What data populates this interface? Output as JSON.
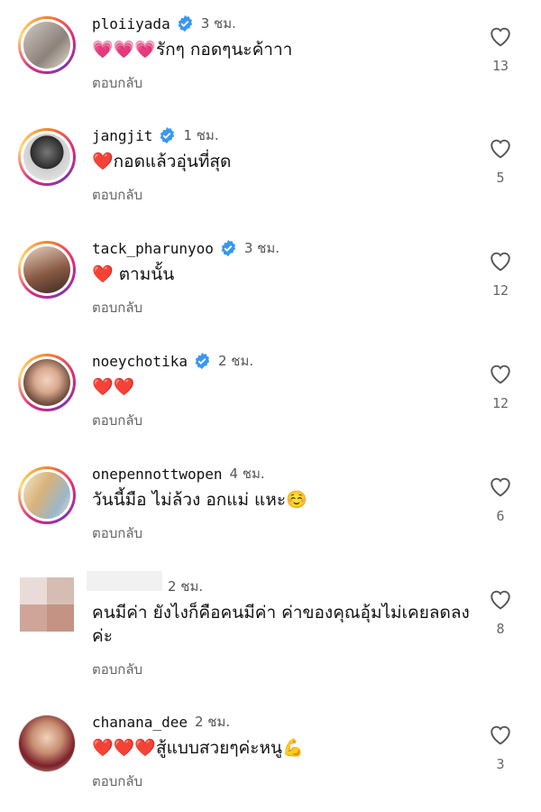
{
  "reply_label": "ตอบกลับ",
  "colors": {
    "verified": "#3897f0",
    "heart": "#e0245e",
    "muted": "#666666"
  },
  "comments": [
    {
      "username": "ploiiyada",
      "verified": true,
      "time": "3 ชม.",
      "text": "💗💗💗รักๆ กอดๆนะค้าาา",
      "likes": "13"
    },
    {
      "username": "jangjit",
      "verified": true,
      "time": "1 ชม.",
      "text": "❤️กอดแล้วอุ่นที่สุด",
      "likes": "5"
    },
    {
      "username": "tack_pharunyoo",
      "verified": true,
      "time": "3 ชม.",
      "text": "❤️ ตามนั้น",
      "likes": "12"
    },
    {
      "username": "noeychotika",
      "verified": true,
      "time": "2 ชม.",
      "text": "❤️❤️",
      "likes": "12"
    },
    {
      "username": "onepennottwopen",
      "verified": false,
      "time": "4 ชม.",
      "text": "วันนี้มือ ไม่ล้วง อกแม่ แหะ☺️",
      "likes": "6"
    },
    {
      "username": "",
      "verified": false,
      "time": "2 ชม.",
      "text": "คนมีค่า ยังไงก็คือคนมีค่า ค่าของคุณอุ้มไม่เคยลดลงค่ะ",
      "likes": "8"
    },
    {
      "username": "chanana_dee",
      "verified": false,
      "time": "2 ชม.",
      "text": "❤️❤️❤️สู้แบบสวยๆค่ะหนู💪",
      "likes": "3"
    }
  ]
}
